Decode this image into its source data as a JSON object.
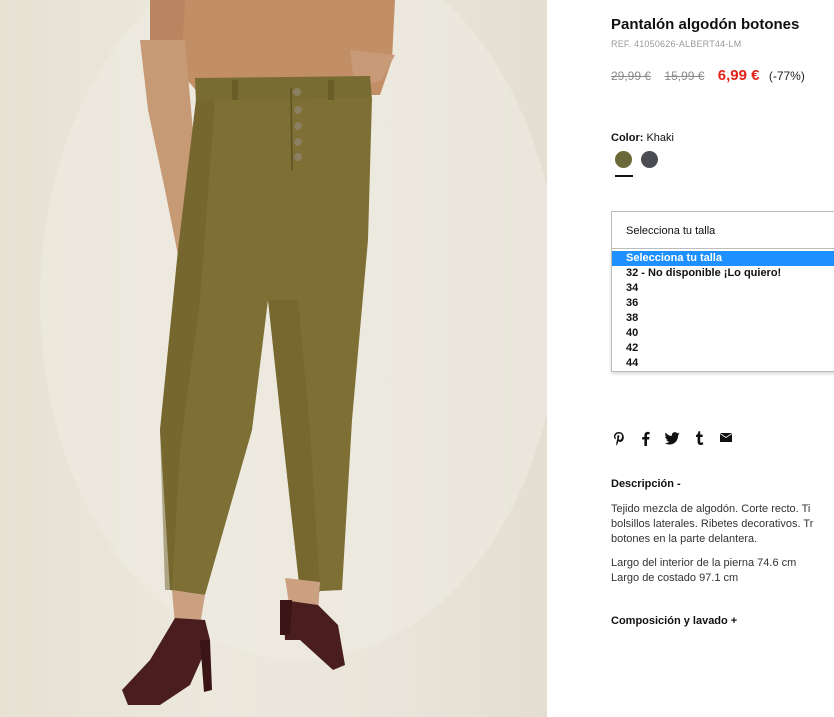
{
  "product": {
    "title": "Pantalón algodón botones",
    "ref": "REF. 41050626-ALBERT44-LM",
    "price_original": "29,99 €",
    "price_previous": "15,99 €",
    "price_current": "6,99 €",
    "discount": "(-77%)"
  },
  "color": {
    "label": "Color:",
    "value": "Khaki",
    "swatches": [
      {
        "name": "khaki",
        "hex": "#6b6839"
      },
      {
        "name": "grey",
        "hex": "#4b4d52"
      }
    ]
  },
  "size": {
    "selected": "Selecciona tu talla",
    "options": [
      "Selecciona tu talla",
      "32 - No disponible ¡Lo quiero!",
      "34",
      "36",
      "38",
      "40",
      "42",
      "44"
    ]
  },
  "share": {
    "icons": [
      "pinterest-icon",
      "facebook-icon",
      "twitter-icon",
      "tumblr-icon",
      "email-icon"
    ]
  },
  "description": {
    "heading": "Descripción  -",
    "lines": [
      "Tejido mezcla de algodón. Corte recto. Ti",
      "bolsillos laterales. Ribetes decorativos. Tr",
      "botones en la parte delantera."
    ],
    "measure_1": "Largo del interior de la pierna 74.6 cm",
    "measure_2": "Largo de costado 97.1 cm"
  },
  "composition": {
    "heading": "Composición y lavado  +"
  },
  "colors": {
    "price_sale": "#e2231a",
    "dropdown_highlight": "#1e90ff"
  }
}
